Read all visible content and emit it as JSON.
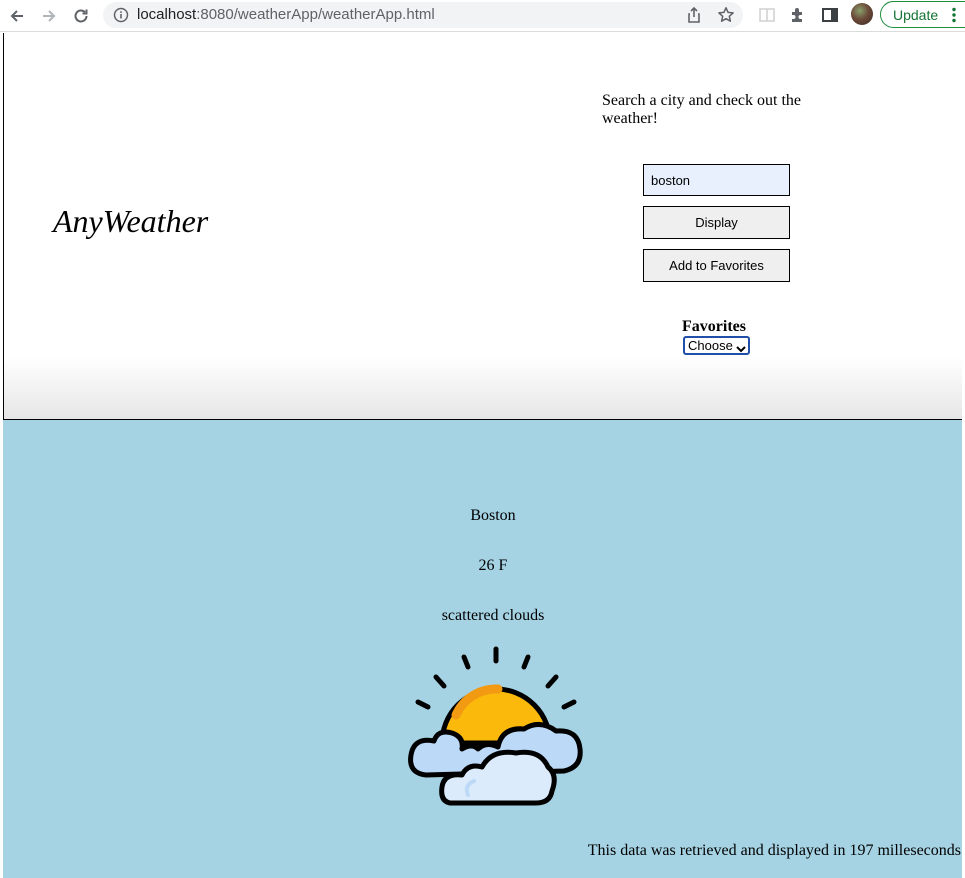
{
  "browser": {
    "url_host": "localhost",
    "url_rest": ":8080/weatherApp/weatherApp.html",
    "update_label": "Update"
  },
  "header": {
    "title": "AnyWeather",
    "prompt": "Search a city and check out the weather!",
    "search_value": "boston",
    "display_label": "Display",
    "favorites_button_label": "Add to Favorites",
    "favorites_heading": "Favorites",
    "favorites_selected": "Choose"
  },
  "weather": {
    "city": "Boston",
    "temperature": "26 F",
    "description": "scattered clouds",
    "icon": "sun-behind-clouds-icon",
    "timing_text": "This data was retrieved and displayed in 197 milleseconds"
  },
  "colors": {
    "weather_background": "#a5d3e3",
    "input_background": "#e8f0fe",
    "sun": "#fbb90c",
    "cloud": "#bcd9f8"
  }
}
